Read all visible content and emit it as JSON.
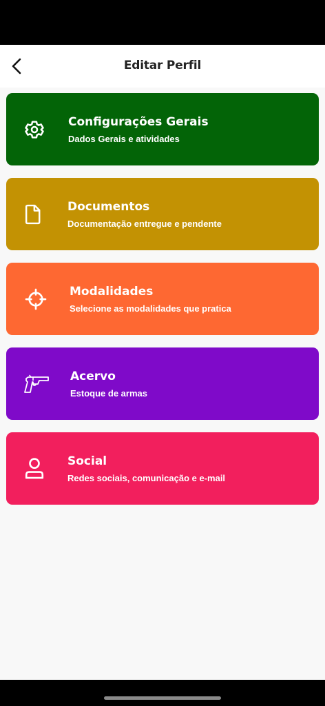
{
  "header": {
    "title": "Editar Perfil"
  },
  "menu": [
    {
      "title": "Configurações Gerais",
      "subtitle": "Dados Gerais e atividades",
      "color": "#036407",
      "icon": "gear-icon"
    },
    {
      "title": "Documentos",
      "subtitle": "Documentação entregue e pendente",
      "color": "#c39203",
      "icon": "document-icon"
    },
    {
      "title": "Modalidades",
      "subtitle": "Selecione as modalidades que pratica",
      "color": "#fe6832",
      "icon": "crosshair-icon"
    },
    {
      "title": "Acervo",
      "subtitle": "Estoque de armas",
      "color": "#7f0ac9",
      "icon": "revolver-icon"
    },
    {
      "title": "Social",
      "subtitle": "Redes sociais, comunicação e e-mail",
      "color": "#f21f5d",
      "icon": "user-icon"
    }
  ]
}
